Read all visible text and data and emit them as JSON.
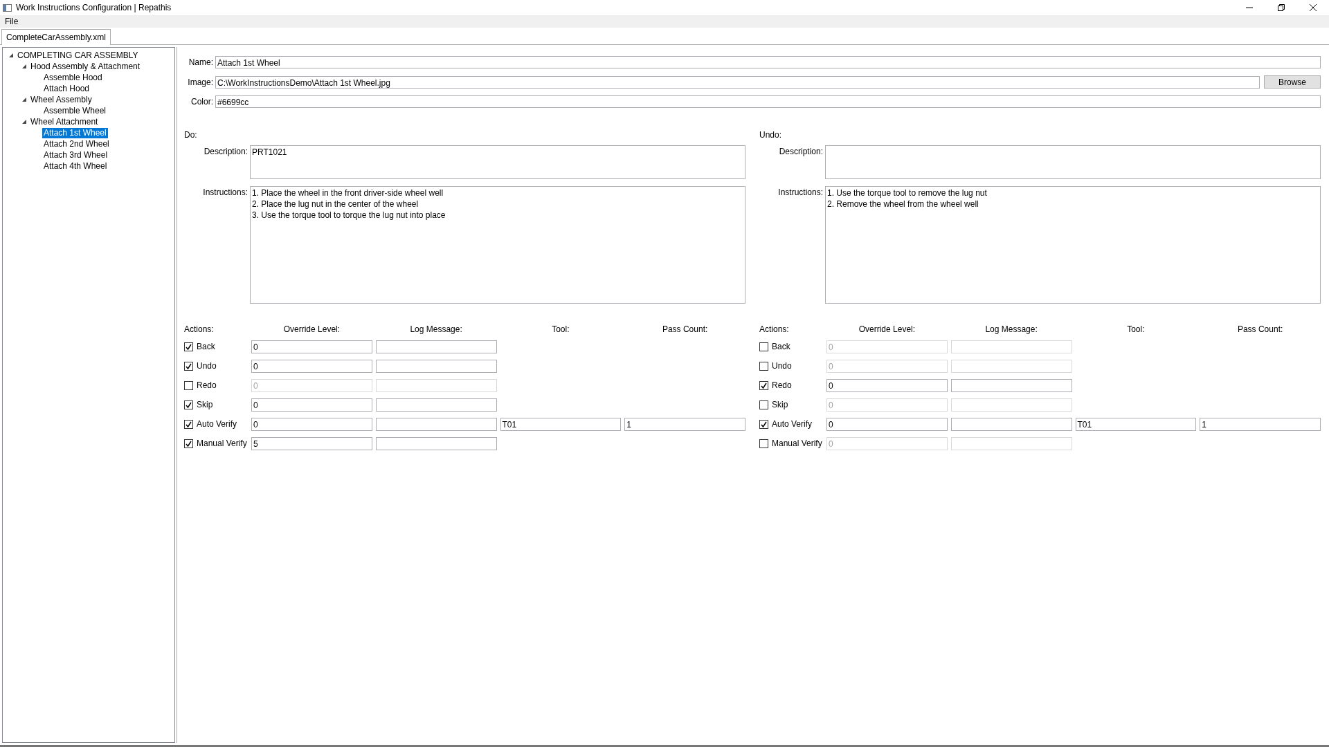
{
  "window": {
    "title": "Work Instructions Configuration | Repathis"
  },
  "menu": [
    "File"
  ],
  "document_tabs": [
    {
      "label": "CompleteCarAssembly.xml",
      "selected": true
    }
  ],
  "tree": [
    {
      "label": "COMPLETING CAR ASSEMBLY",
      "expanded": true,
      "selected": false,
      "children": [
        {
          "label": "Hood Assembly & Attachment",
          "expanded": true,
          "selected": false,
          "children": [
            {
              "label": "Assemble Hood",
              "selected": false
            },
            {
              "label": "Attach Hood",
              "selected": false
            }
          ]
        },
        {
          "label": "Wheel Assembly",
          "expanded": true,
          "selected": false,
          "children": [
            {
              "label": "Assemble Wheel",
              "selected": false
            }
          ]
        },
        {
          "label": "Wheel Attachment",
          "expanded": true,
          "selected": false,
          "children": [
            {
              "label": "Attach 1st Wheel",
              "selected": true
            },
            {
              "label": "Attach 2nd Wheel",
              "selected": false
            },
            {
              "label": "Attach 3rd Wheel",
              "selected": false
            },
            {
              "label": "Attach 4th Wheel",
              "selected": false
            }
          ]
        }
      ]
    }
  ],
  "form": {
    "name_label": "Name:",
    "name": "Attach 1st Wheel",
    "image_label": "Image:",
    "image": "C:\\WorkInstructionsDemo\\Attach 1st Wheel.jpg",
    "browse_button": "Browse",
    "color_label": "Color:",
    "color_text": "#6699cc"
  },
  "sections": [
    {
      "heading": "Do:",
      "description_label": "Description:",
      "description": "PRT1021",
      "instructions_label": "Instructions:",
      "instructions": [
        "1. Place the wheel in the front driver-side wheel well",
        "2. Place the lug nut in the center of the wheel",
        "3. Use the torque tool to torque the lug nut into place"
      ],
      "actions": {
        "columns": [
          "Actions:",
          "Override Level:",
          "Log Message:",
          "Tool:",
          "Pass Count:"
        ],
        "rows": [
          {
            "label": "Back",
            "checked": true,
            "override_level": "0",
            "log_message": ""
          },
          {
            "label": "Undo",
            "checked": true,
            "override_level": "0",
            "log_message": ""
          },
          {
            "label": "Redo",
            "checked": false,
            "override_level": "0",
            "log_message": ""
          },
          {
            "label": "Skip",
            "checked": true,
            "override_level": "0",
            "log_message": ""
          },
          {
            "label": "Auto Verify",
            "checked": true,
            "override_level": "0",
            "log_message": "",
            "tool": "T01",
            "pass_count": "1"
          },
          {
            "label": "Manual Verify",
            "checked": true,
            "override_level": "5",
            "log_message": ""
          }
        ]
      }
    },
    {
      "heading": "Undo:",
      "description_label": "Description:",
      "instructions_label": "Instructions:",
      "instructions": [
        "1. Use the torque tool to remove the lug nut",
        "2. Remove the wheel from the wheel well"
      ],
      "actions": {
        "columns": [
          "Actions:",
          "Override Level:",
          "Log Message:",
          "Tool:",
          "Pass Count:"
        ],
        "rows": [
          {
            "label": "Back",
            "checked": false,
            "override_level": "0",
            "log_message": ""
          },
          {
            "label": "Undo",
            "checked": false,
            "override_level": "0",
            "log_message": ""
          },
          {
            "label": "Redo",
            "checked": true,
            "override_level": "0",
            "log_message": ""
          },
          {
            "label": "Skip",
            "checked": false,
            "override_level": "0",
            "log_message": ""
          },
          {
            "label": "Auto Verify",
            "checked": true,
            "override_level": "0",
            "log_message": "",
            "tool": "T01",
            "pass_count": "1"
          },
          {
            "label": "Manual Verify",
            "checked": false,
            "override_level": "0",
            "log_message": ""
          }
        ]
      }
    }
  ]
}
